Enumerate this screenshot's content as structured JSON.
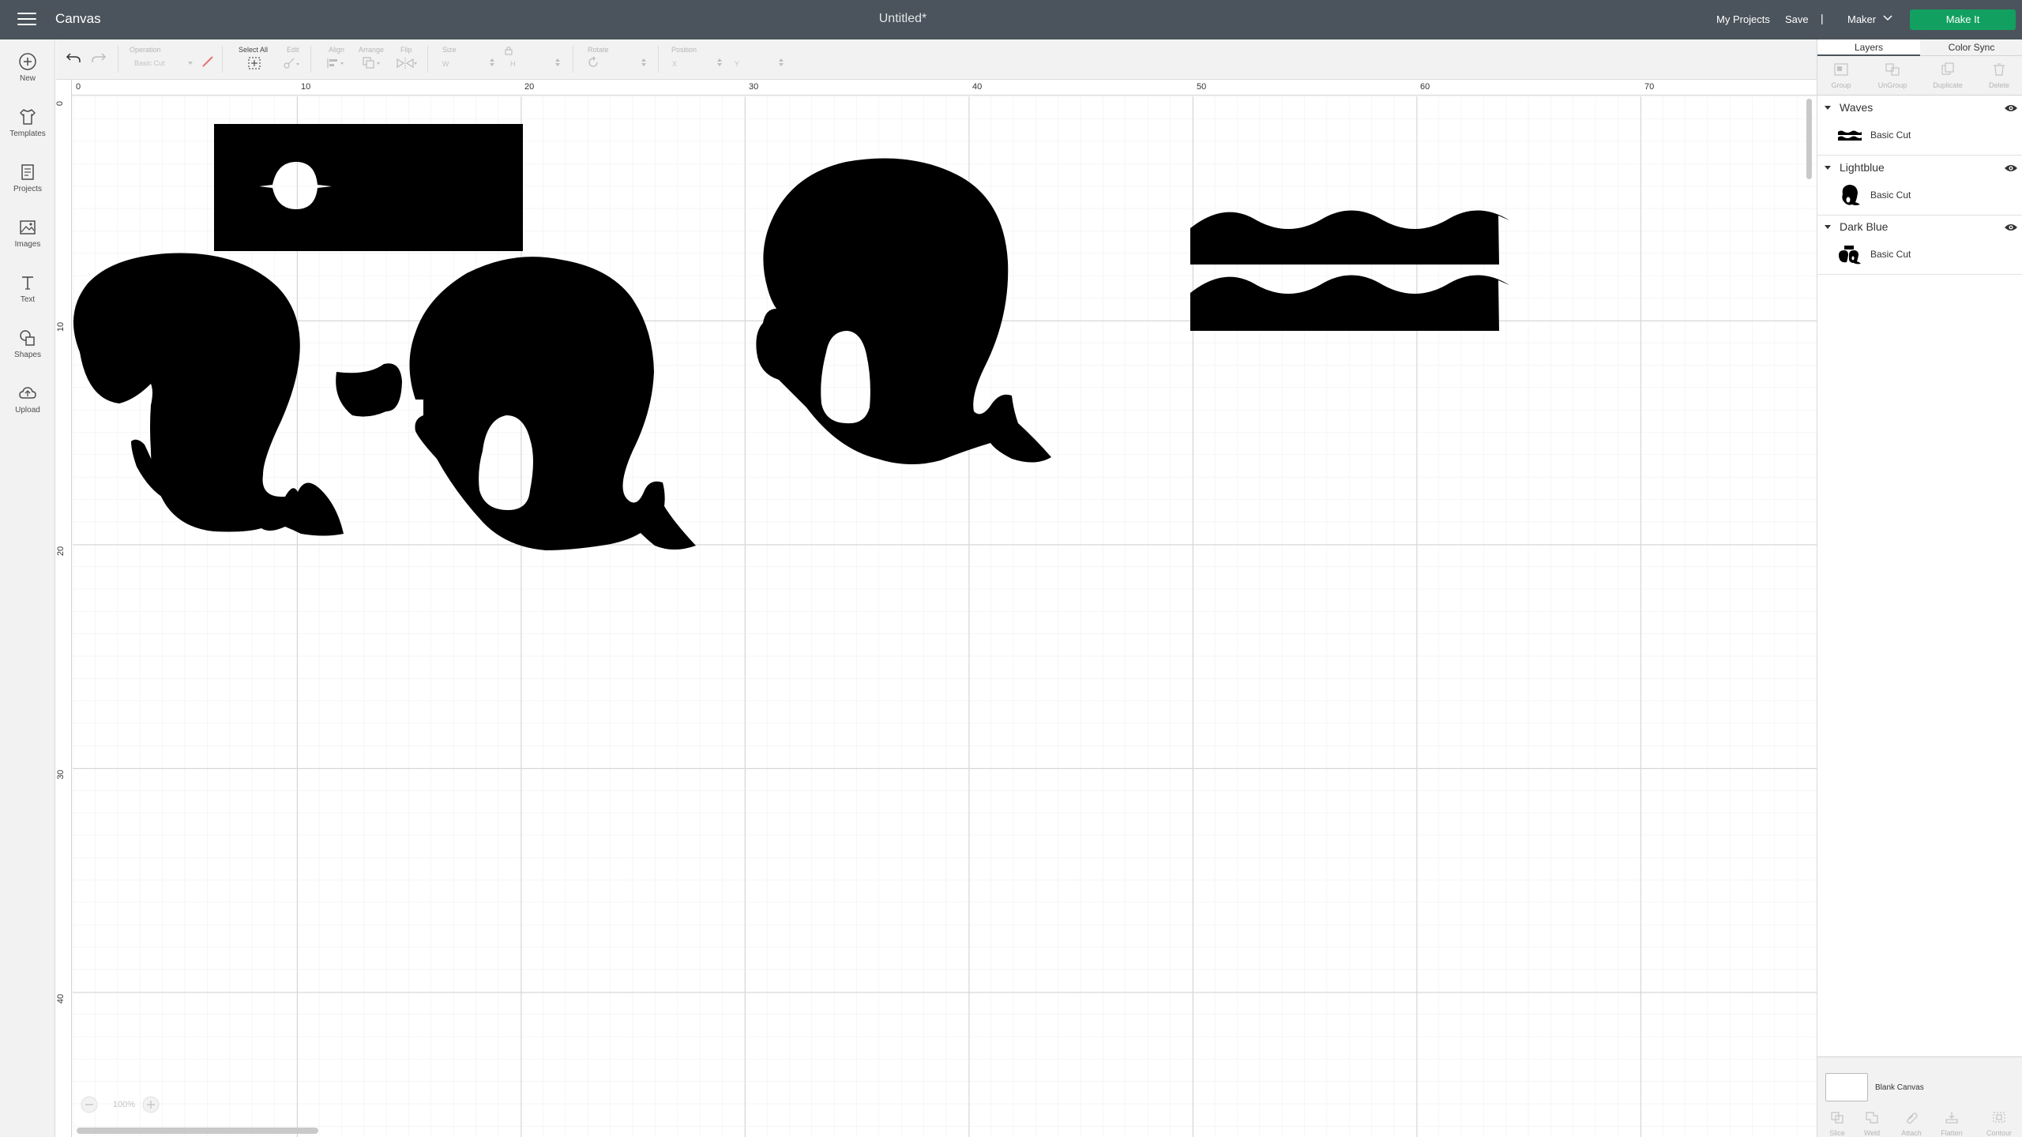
{
  "header": {
    "app_title": "Canvas",
    "doc_title": "Untitled*",
    "my_projects": "My Projects",
    "save": "Save",
    "separator": "|",
    "machine": "Maker",
    "make_it": "Make It"
  },
  "nav": {
    "items": [
      {
        "label": "New",
        "icon": "plus-circle-icon"
      },
      {
        "label": "Templates",
        "icon": "shirt-icon"
      },
      {
        "label": "Projects",
        "icon": "projects-icon"
      },
      {
        "label": "Images",
        "icon": "image-icon"
      },
      {
        "label": "Text",
        "icon": "text-icon"
      },
      {
        "label": "Shapes",
        "icon": "shapes-icon"
      },
      {
        "label": "Upload",
        "icon": "cloud-upload-icon"
      }
    ]
  },
  "toolbar": {
    "operation_label": "Operation",
    "operation_value": "Basic Cut",
    "select_all": "Select All",
    "edit": "Edit",
    "align": "Align",
    "arrange": "Arrange",
    "flip": "Flip",
    "size": "Size",
    "size_w": "W",
    "size_h": "H",
    "rotate": "Rotate",
    "position": "Position",
    "pos_x": "X",
    "pos_y": "Y"
  },
  "canvas": {
    "ruler_top": [
      "0",
      "10",
      "20",
      "30",
      "40",
      "50",
      "60",
      "70"
    ],
    "ruler_left": [
      "0",
      "10",
      "20",
      "30",
      "40"
    ],
    "zoom": "100%"
  },
  "panel": {
    "tab_layers": "Layers",
    "tab_color_sync": "Color Sync",
    "tools": [
      "Group",
      "UnGroup",
      "Duplicate",
      "Delete"
    ],
    "layers": [
      {
        "name": "Waves",
        "operation": "Basic Cut"
      },
      {
        "name": "Lightblue",
        "operation": "Basic Cut"
      },
      {
        "name": "Dark Blue",
        "operation": "Basic Cut"
      }
    ],
    "blank_canvas": "Blank Canvas",
    "bottom_tools": [
      "Slice",
      "Weld",
      "Attach",
      "Flatten",
      "Contour"
    ]
  },
  "colors": {
    "header_bg": "#4b545c",
    "make_it": "#12a060",
    "shape_fill": "#000000"
  }
}
